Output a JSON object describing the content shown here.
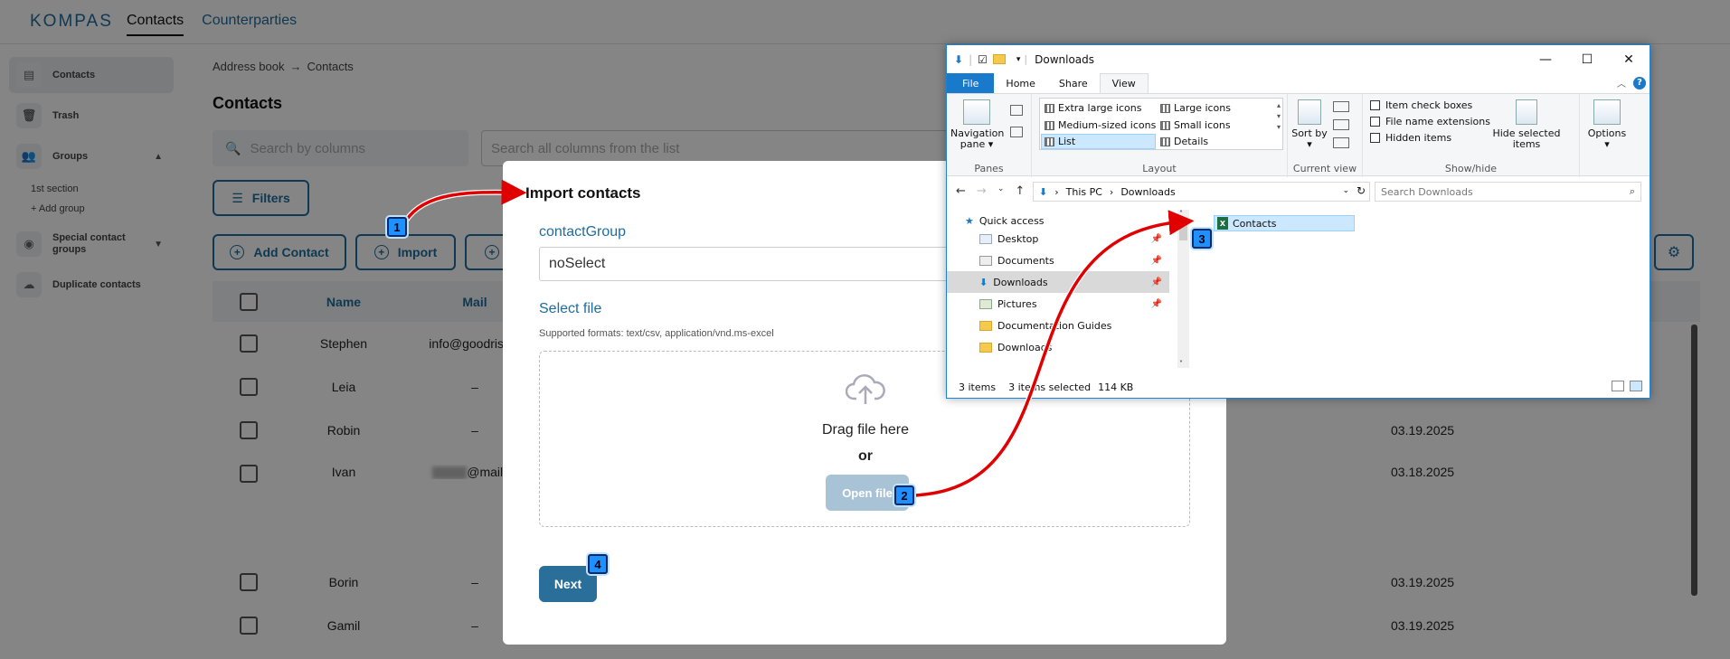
{
  "app": {
    "logo": "KOMPAS",
    "nav": [
      "Contacts",
      "Counterparties"
    ]
  },
  "sidebar": {
    "items": [
      {
        "label": "Contacts"
      },
      {
        "label": "Trash"
      },
      {
        "label": "Groups"
      },
      {
        "label": "Special contact groups"
      },
      {
        "label": "Duplicate contacts"
      }
    ],
    "subitems": [
      "1st section",
      "+ Add group"
    ]
  },
  "main": {
    "breadcrumb": [
      "Address book",
      "Contacts"
    ],
    "title": "Contacts",
    "search_placeholder": "Search by columns",
    "search_all_placeholder": "Search all columns from the list",
    "filters_label": "Filters",
    "add_contact_label": "Add Contact",
    "import_label": "Import",
    "columns": [
      "Name",
      "Mail"
    ],
    "rows": [
      {
        "name": "Stephen",
        "mail": "info@goodrise.c",
        "date": ""
      },
      {
        "name": "Leia",
        "mail": "–",
        "date": ""
      },
      {
        "name": "Robin",
        "mail": "–",
        "date": "03.19.2025"
      },
      {
        "name": "Ivan",
        "mail": "@mail.te",
        "date": "03.18.2025"
      },
      {
        "name": "Borin",
        "mail": "–",
        "date": "03.19.2025"
      },
      {
        "name": "Gamil",
        "mail": "–",
        "date": "03.19.2025"
      }
    ]
  },
  "modal": {
    "title": "Import contacts",
    "group_label": "contactGroup",
    "group_value": "noSelect",
    "file_label": "Select file",
    "formats": "Supported formats: text/csv, application/vnd.ms-excel",
    "drag_text": "Drag file here",
    "or_text": "or",
    "open_file": "Open file",
    "next": "Next"
  },
  "steps": [
    "1",
    "2",
    "3",
    "4"
  ],
  "explorer": {
    "title": "Downloads",
    "tabs": [
      "File",
      "Home",
      "Share",
      "View"
    ],
    "panes": {
      "navigation_pane": "Navigation pane",
      "label": "Panes"
    },
    "layout": {
      "items": [
        "Extra large icons",
        "Large icons",
        "Medium-sized icons",
        "Small icons",
        "List",
        "Details"
      ],
      "label": "Layout"
    },
    "current_view": {
      "sort": "Sort by",
      "label": "Current view"
    },
    "show_hide": {
      "checks": [
        "Item check boxes",
        "File name extensions",
        "Hidden items"
      ],
      "hide_selected": "Hide selected items",
      "label": "Show/hide"
    },
    "options": "Options",
    "address": [
      "This PC",
      "Downloads"
    ],
    "search_placeholder": "Search Downloads",
    "nav": [
      "Quick access",
      "Desktop",
      "Documents",
      "Downloads",
      "Pictures",
      "Documentation Guides",
      "Downloads"
    ],
    "files": [
      "Contacts"
    ],
    "status": {
      "count": "3 items",
      "selected": "3 items selected",
      "size": "114 KB"
    }
  },
  "colors": {
    "accent": "#1e6e9e",
    "arrow": "#e00000",
    "badge": "#1e90ff"
  }
}
